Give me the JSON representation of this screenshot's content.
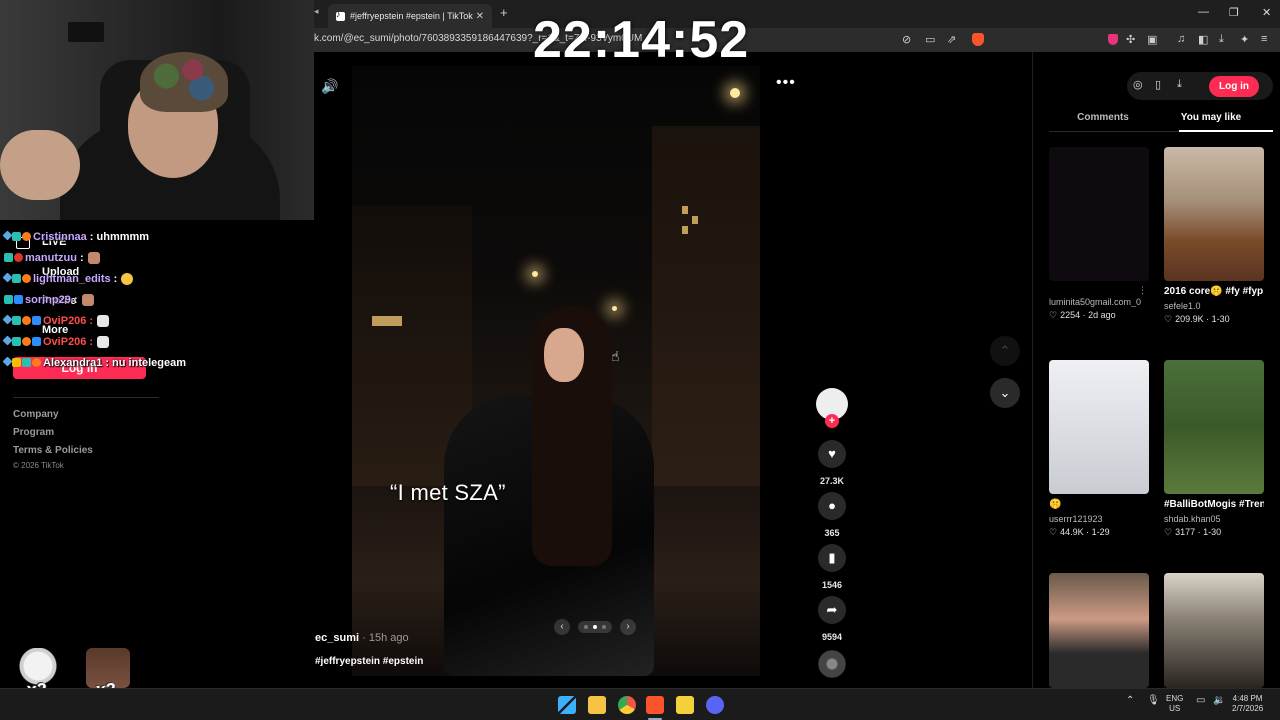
{
  "overlay": {
    "clock": "22:14:52",
    "chat": [
      {
        "user": "Cristinnaa",
        "message": "uhmmmm",
        "user_color": "#c8a6ff",
        "emote": null
      },
      {
        "user": "manutzuu",
        "message": "",
        "user_color": "#c8a6ff",
        "emote": "face"
      },
      {
        "user": "lightman_edits",
        "message": "",
        "user_color": "#c8a6ff",
        "emote": "yellow"
      },
      {
        "user": "sorinp29",
        "message": "",
        "user_color": "#c8a6ff",
        "emote": "face"
      },
      {
        "user": "OviP206",
        "message": "",
        "user_color": "#ff4b4b",
        "emote": "white"
      },
      {
        "user": "OviP206",
        "message": "",
        "user_color": "#ff4b4b",
        "emote": "white"
      },
      {
        "user": "Alexandra1",
        "message": "nu intelegeam",
        "user_color": "#ffffff",
        "emote": null
      }
    ],
    "stickers": [
      {
        "count": "x3"
      },
      {
        "count": "x3"
      }
    ]
  },
  "browser": {
    "tab_title": "#jeffryepstein #epstein | TikTok",
    "url": "k.com/@ec_sumi/photo/7603893359186447639?_r=1&_t=ZN-93Vym0UM"
  },
  "left_nav": {
    "live": "LIVE",
    "upload": "Upload",
    "profile": "Profile",
    "more": "More",
    "login": "Log in",
    "footer": {
      "company": "Company",
      "program": "Program",
      "terms": "Terms & Policies",
      "copyright": "© 2026 TikTok"
    }
  },
  "post": {
    "caption": "“I met SZA”",
    "author": "ec_sumi",
    "time": "15h ago",
    "hashtags": "#jeffryepstein #epstein",
    "likes": "27.3K",
    "comments": "365",
    "saves": "1546",
    "shares": "9594"
  },
  "right_panel": {
    "login": "Log in",
    "tabs": [
      "Comments",
      "You may like"
    ],
    "active_tab": "You may like",
    "cards": [
      {
        "title": "",
        "user": "luminita50gmail.com_0",
        "likes": "2254",
        "date": "2d ago"
      },
      {
        "title": "2016 core🤫 #fy #fyp #forupage...",
        "user": "sefele1.0",
        "likes": "209.9K",
        "date": "1-30"
      },
      {
        "title": "🤫",
        "user": "userrr121923",
        "likes": "44.9K",
        "date": "1-29"
      },
      {
        "title": "#BalliBotMogis #TrendingReels...",
        "user": "shdab.khan05",
        "likes": "3177",
        "date": "1-30"
      },
      {
        "title": "",
        "user": "",
        "likes": "",
        "date": ""
      },
      {
        "title": "",
        "user": "",
        "likes": "",
        "date": ""
      }
    ]
  },
  "taskbar": {
    "lang": "ENG",
    "region": "US",
    "time": "4:48 PM",
    "date": "2/7/2026"
  }
}
